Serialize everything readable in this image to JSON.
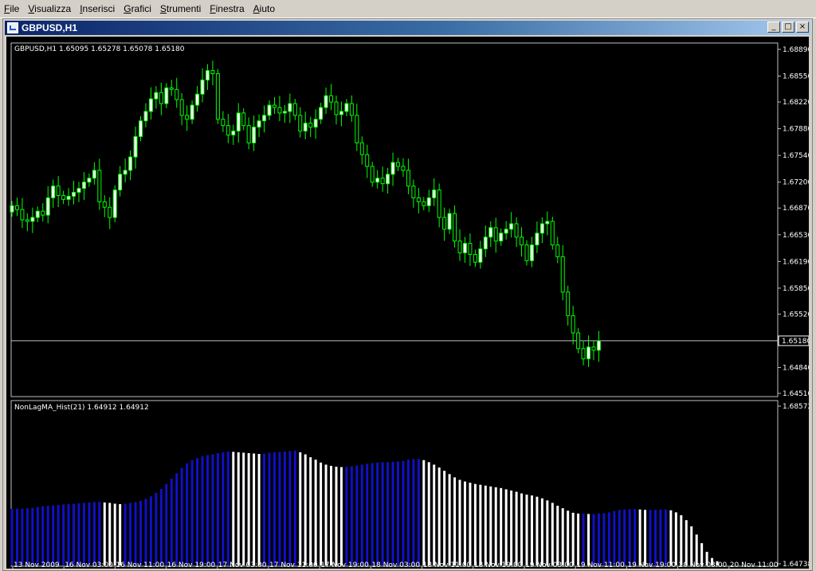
{
  "menu": [
    "File",
    "Visualizza",
    "Inserisci",
    "Grafici",
    "Strumenti",
    "Finestra",
    "Aiuto"
  ],
  "window": {
    "title": "GBPUSD,H1",
    "buttons": {
      "minimize": "_",
      "maximize": "□",
      "close": "×"
    }
  },
  "colors": {
    "background": "#000000",
    "grid_frame": "#c0c0c0",
    "bull_candle": "#ffffff",
    "bear_candle": "#000000",
    "candle_wick": "#00ff00",
    "hist_up": "#1010c8",
    "hist_down": "#ffffff",
    "bid_line": "#c0c0c0"
  },
  "chart_data": [
    {
      "type": "candlestick",
      "title": "GBPUSD,H1  1.65095 1.65278 1.65078 1.65180",
      "ylim": [
        1.6451,
        1.6889
      ],
      "y_ticks": [
        "1.68890",
        "1.68550",
        "1.68220",
        "1.67880",
        "1.67540",
        "1.67200",
        "1.66870",
        "1.66530",
        "1.66190",
        "1.65850",
        "1.65520",
        "1.65180",
        "1.64840",
        "1.64510"
      ],
      "current_price": "1.65180",
      "closes": [
        1.669,
        1.6685,
        1.6672,
        1.667,
        1.6675,
        1.6683,
        1.6678,
        1.67,
        1.6715,
        1.6703,
        1.6698,
        1.6702,
        1.6707,
        1.6712,
        1.672,
        1.6725,
        1.6735,
        1.6695,
        1.6688,
        1.6675,
        1.671,
        1.673,
        1.6735,
        1.6752,
        1.6778,
        1.6798,
        1.681,
        1.6826,
        1.6834,
        1.682,
        1.684,
        1.6838,
        1.6825,
        1.6805,
        1.68,
        1.6818,
        1.6832,
        1.685,
        1.6862,
        1.6858,
        1.68,
        1.6792,
        1.678,
        1.6785,
        1.6808,
        1.6792,
        1.677,
        1.679,
        1.6798,
        1.6805,
        1.6818,
        1.6815,
        1.6808,
        1.681,
        1.682,
        1.6805,
        1.6785,
        1.6795,
        1.679,
        1.68,
        1.6815,
        1.683,
        1.6822,
        1.6806,
        1.681,
        1.682,
        1.6805,
        1.677,
        1.6755,
        1.674,
        1.672,
        1.6725,
        1.6718,
        1.673,
        1.6745,
        1.674,
        1.6735,
        1.6715,
        1.67,
        1.6695,
        1.669,
        1.67,
        1.671,
        1.6675,
        1.666,
        1.668,
        1.6645,
        1.663,
        1.6642,
        1.6628,
        1.6618,
        1.6635,
        1.665,
        1.6662,
        1.6645,
        1.6655,
        1.666,
        1.6667,
        1.665,
        1.664,
        1.662,
        1.664,
        1.6655,
        1.6667,
        1.667,
        1.664,
        1.6625,
        1.658,
        1.655,
        1.6528,
        1.6508,
        1.6495,
        1.651,
        1.6506,
        1.6518
      ],
      "x_ticks": [
        "13 Nov 2009",
        "16 Nov 03:00",
        "16 Nov 11:00",
        "16 Nov 19:00",
        "17 Nov 03:00",
        "17 Nov 11:00",
        "17 Nov 19:00",
        "18 Nov 03:00",
        "18 Nov 11:00",
        "18 Nov 19:00",
        "19 Nov 03:00",
        "19 Nov 11:00",
        "19 Nov 19:00",
        "20 Nov 03:00",
        "20 Nov 11:00"
      ]
    },
    {
      "type": "bar",
      "title": "NonLagMA_Hist(21) 1.64912 1.64912",
      "ylim": [
        1.64738,
        1.68572
      ],
      "y_ticks": [
        "1.68572",
        "1.64738"
      ],
      "values": [
        1.6608,
        1.6608,
        1.6608,
        1.6609,
        1.661,
        1.6612,
        1.6614,
        1.6615,
        1.6616,
        1.6617,
        1.6618,
        1.6619,
        1.662,
        1.6621,
        1.6622,
        1.6623,
        1.6624,
        1.6625,
        1.6623,
        1.6622,
        1.662,
        1.6619,
        1.662,
        1.6622,
        1.6624,
        1.6627,
        1.6632,
        1.6638,
        1.6646,
        1.6656,
        1.6668,
        1.6681,
        1.6694,
        1.6707,
        1.6718,
        1.6726,
        1.6731,
        1.6735,
        1.6738,
        1.674,
        1.6743,
        1.6745,
        1.6747,
        1.6746,
        1.6745,
        1.6744,
        1.6743,
        1.6742,
        1.6741,
        1.6742,
        1.6744,
        1.6745,
        1.6746,
        1.6747,
        1.6748,
        1.6749,
        1.6745,
        1.674,
        1.6733,
        1.6727,
        1.672,
        1.6715,
        1.6712,
        1.671,
        1.6709,
        1.671,
        1.6711,
        1.6713,
        1.6715,
        1.6717,
        1.6719,
        1.672,
        1.6721,
        1.6721,
        1.6722,
        1.6723,
        1.6724,
        1.6727,
        1.6729,
        1.6729,
        1.6726,
        1.6721,
        1.6715,
        1.6708,
        1.67,
        1.6692,
        1.6684,
        1.6678,
        1.6674,
        1.6671,
        1.6668,
        1.6666,
        1.6664,
        1.6662,
        1.666,
        1.6658,
        1.6655,
        1.6652,
        1.6649,
        1.6645,
        1.6642,
        1.664,
        1.6637,
        1.6633,
        1.6628,
        1.6622,
        1.6615,
        1.6609,
        1.6603,
        1.6598,
        1.6596,
        1.6596,
        1.6595,
        1.6595,
        1.6596,
        1.6597,
        1.6599,
        1.6602,
        1.6605,
        1.6606,
        1.6607,
        1.6607,
        1.6606,
        1.6605,
        1.6605,
        1.6605,
        1.6606,
        1.6606,
        1.6604,
        1.6599,
        1.6592,
        1.658,
        1.6565,
        1.6545,
        1.6524,
        1.6503,
        1.6488,
        1.648
      ]
    }
  ]
}
